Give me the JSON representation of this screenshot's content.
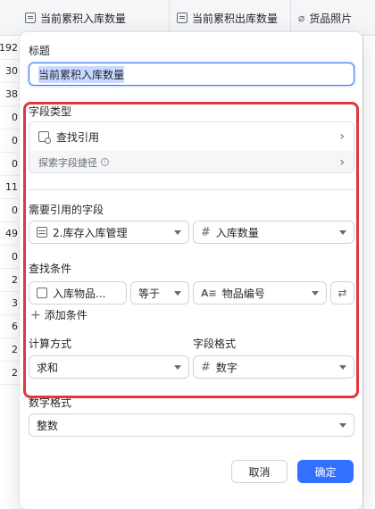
{
  "table": {
    "headers": [
      {
        "icon": "formula-icon",
        "label": "当前累积入库数量"
      },
      {
        "icon": "formula-icon",
        "label": "当前累积出库数量"
      },
      {
        "icon": "paperclip-icon",
        "label": "货品照片"
      }
    ],
    "row_numbers": [
      "192",
      "30",
      "38",
      "0",
      "0",
      "0",
      "11",
      "0",
      "49",
      "0",
      "2",
      "3",
      "6",
      "2",
      "2"
    ]
  },
  "modal": {
    "title_label": "标题",
    "title_value": "当前累积入库数量",
    "field_type_label": "字段类型",
    "field_type_value": "查找引用",
    "explore_label": "探索字段捷径",
    "ref_field_label": "需要引用的字段",
    "ref_table": "2.库存入库管理",
    "ref_field": "入库数量",
    "condition_label": "查找条件",
    "condition_field": "入库物品...",
    "condition_operator": "等于",
    "condition_target": "物品编号",
    "add_condition": "添加条件",
    "calc_label": "计算方式",
    "calc_value": "求和",
    "format_label": "字段格式",
    "format_value": "数字",
    "number_format_label": "数字格式",
    "number_format_value": "整数",
    "cancel": "取消",
    "confirm": "确定"
  },
  "colors": {
    "accent": "#3370ff",
    "highlight_frame": "#e0383e"
  }
}
